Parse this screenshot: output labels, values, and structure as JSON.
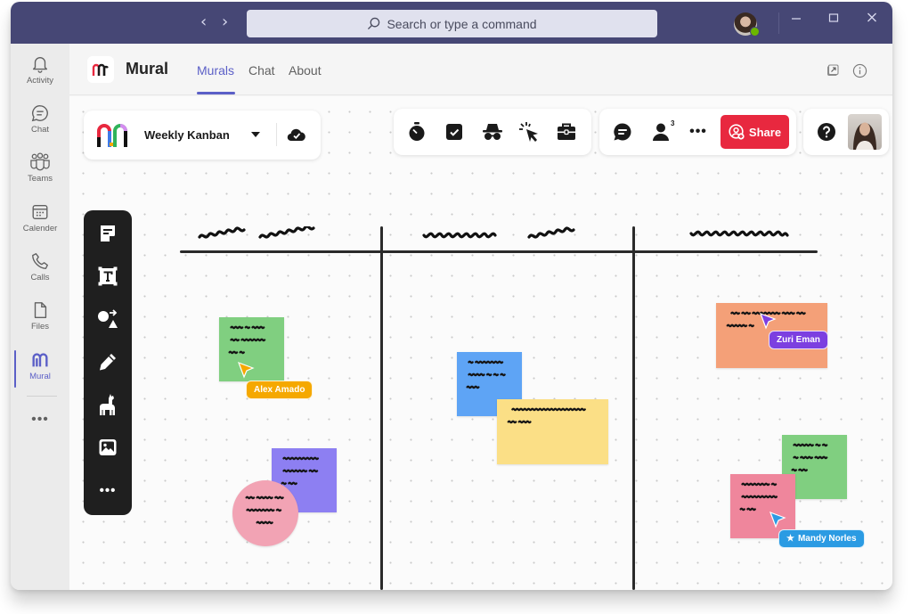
{
  "titlebar": {
    "back_icon": "chevron-left-icon",
    "forward_icon": "chevron-right-icon",
    "search_placeholder": "Search or type a command",
    "window_controls": [
      "minimize",
      "maximize",
      "close"
    ],
    "presence": "available"
  },
  "rail": {
    "items": [
      {
        "label": "Activity",
        "icon": "bell-icon"
      },
      {
        "label": "Chat",
        "icon": "chat-icon"
      },
      {
        "label": "Teams",
        "icon": "teams-icon"
      },
      {
        "label": "Calender",
        "icon": "calendar-icon"
      },
      {
        "label": "Calls",
        "icon": "phone-icon"
      },
      {
        "label": "Files",
        "icon": "file-icon"
      },
      {
        "label": "Mural",
        "icon": "mural-icon",
        "active": true
      }
    ],
    "more_label": "•••"
  },
  "app_header": {
    "app_name": "Mural",
    "tabs": [
      {
        "label": "Murals",
        "active": true
      },
      {
        "label": "Chat"
      },
      {
        "label": "About"
      }
    ],
    "right_icons": [
      "popout-icon",
      "info-icon"
    ]
  },
  "mural_panel": {
    "title": "Weekly Kanban",
    "dropdown_icon": "caret-down-icon",
    "sync_icon": "cloud-check-icon"
  },
  "top_tools": [
    "timer-icon",
    "voting-icon",
    "private-mode-icon",
    "laser-pointer-icon",
    "toolbox-icon"
  ],
  "collab": {
    "comment_icon": "comment-icon",
    "collaborator_count": "3",
    "more_label": "•••",
    "share_label": "Share",
    "brand_red": "#e8283f"
  },
  "help_icon": "help-icon",
  "left_tools": [
    "sticky-note-icon",
    "text-icon",
    "shapes-icon",
    "pen-icon",
    "llama-icon",
    "image-icon",
    "more-icon"
  ],
  "board": {
    "columns": 3,
    "column_titles_scribbled": true
  },
  "stickies": [
    {
      "color": "#80cf80",
      "shape": "square",
      "lines": 3
    },
    {
      "color": "#8d7ff2",
      "shape": "square",
      "lines": 3
    },
    {
      "color": "#f2a3b4",
      "shape": "circle",
      "lines": 3
    },
    {
      "color": "#5ea4f5",
      "shape": "square",
      "lines": 3
    },
    {
      "color": "#fbdf86",
      "shape": "rect",
      "lines": 2
    },
    {
      "color": "#f4a078",
      "shape": "rect",
      "lines": 2
    },
    {
      "color": "#80cf80",
      "shape": "square",
      "lines": 3
    },
    {
      "color": "#ef869c",
      "shape": "square",
      "lines": 3
    }
  ],
  "collaborators": [
    {
      "name": "Alex Amado",
      "color": "#f5a800"
    },
    {
      "name": "Zuri Eman",
      "color": "#7c3fe0"
    },
    {
      "name": "Mandy Norles",
      "color": "#2b9be3",
      "icon": "star-icon"
    }
  ]
}
